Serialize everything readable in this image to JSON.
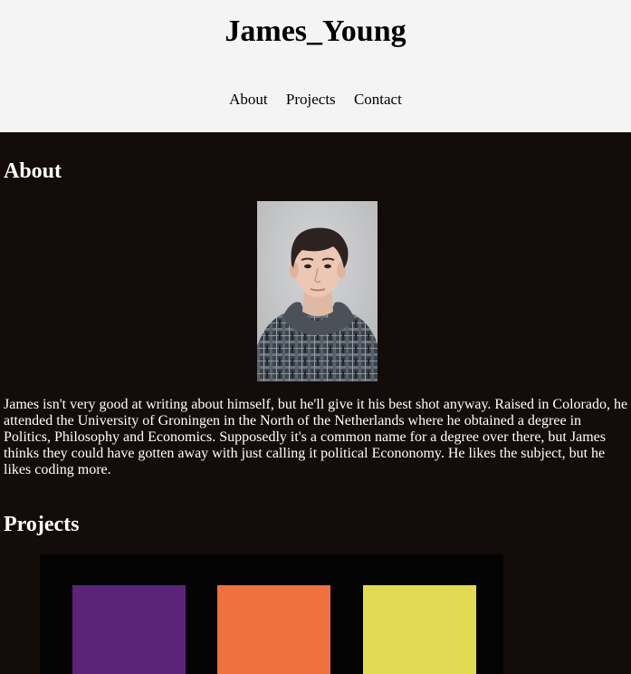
{
  "header": {
    "title": "James_Young",
    "nav": [
      {
        "label": "About"
      },
      {
        "label": "Projects"
      },
      {
        "label": "Contact"
      }
    ]
  },
  "about": {
    "heading": "About",
    "bio": "James isn't very good at writing about himself, but he'll give it his best shot anyway. Raised in Colorado, he attended the University of Groningen in the North of the Netherlands where he obtained a degree in Politics, Philosophy and Economics. Supposedly it's a common name for a degree over there, but James thinks they could have gotten away with just calling it political Econonomy. He likes the subject, but he likes coding more."
  },
  "projects": {
    "heading": "Projects",
    "thumbnail_colors": [
      "#5b2479",
      "#ef713e",
      "#e2da52"
    ]
  },
  "colors": {
    "header_bg": "#f4f4f4",
    "page_bg": "#140b0b",
    "text_light": "#ffffff"
  }
}
